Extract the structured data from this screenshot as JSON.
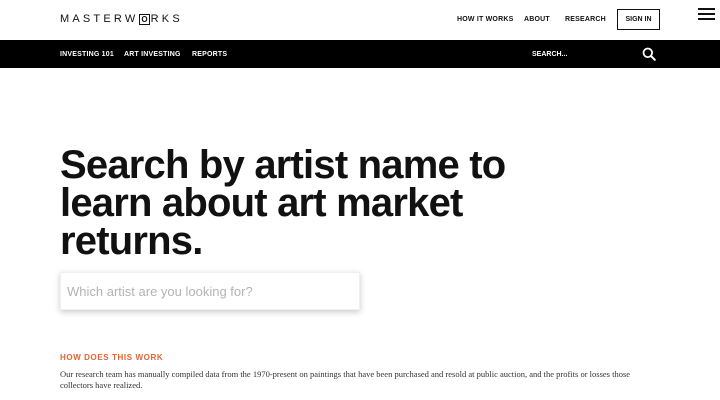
{
  "header": {
    "logo_text_left": "MASTERW",
    "logo_text_box": "O",
    "logo_text_right": "RKS",
    "nav": [
      "HOW IT WORKS",
      "ABOUT",
      "RESEARCH"
    ],
    "signin_label": "SIGN IN",
    "menu_icon": "hamburger-icon"
  },
  "subnav": {
    "items": [
      "INVESTING 101",
      "ART INVESTING",
      "REPORTS"
    ],
    "search_placeholder": "SEARCH...",
    "search_icon": "search-icon"
  },
  "hero": {
    "headline": "Search by artist name to learn about art market returns.",
    "search_placeholder": "Which artist are you looking for?",
    "search_value": ""
  },
  "info": {
    "label": "HOW DOES THIS WORK",
    "text": "Our research team has manually compiled data from the 1970-present on paintings that have been purchased and resold at public auction, and the profits or losses those collectors have realized."
  },
  "colors": {
    "accent": "#e8622a",
    "nav_bar": "#000000",
    "background": "#ffffff"
  }
}
